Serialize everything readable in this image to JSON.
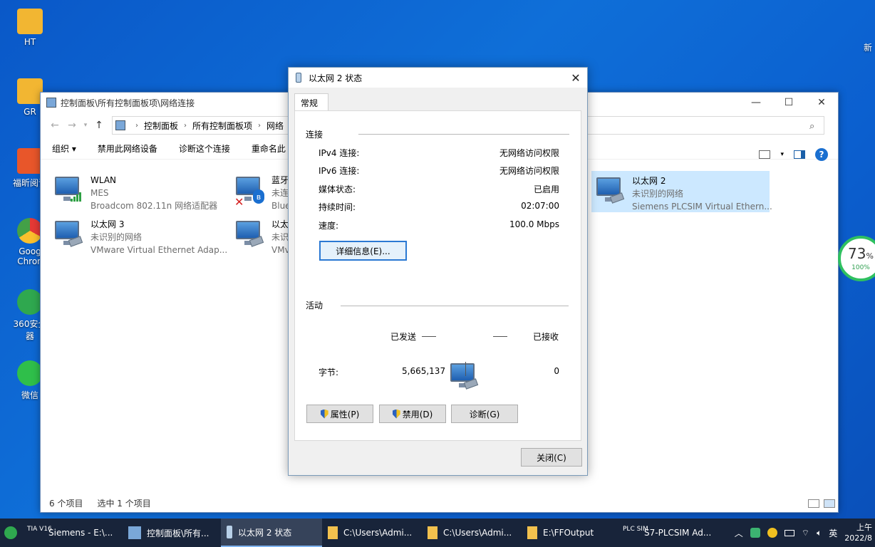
{
  "desktop": {
    "icons": [
      {
        "label": "HT",
        "color": "#f2b632"
      },
      {
        "label": "GR",
        "color": "#f2b632"
      },
      {
        "label": "福昕阅读",
        "color": "#e8562a"
      },
      {
        "label": "Goog Chron",
        "color": "#e53935"
      },
      {
        "label": "360安全 器",
        "color": "#2fa84f"
      },
      {
        "label": "微信",
        "color": "#2fbf4a"
      }
    ],
    "right_label": "新"
  },
  "explorer": {
    "title": "控制面板\\所有控制面板项\\网络连接",
    "breadcrumb": [
      "控制面板",
      "所有控制面板项",
      "网络"
    ],
    "toolbar": [
      "组织 ▾",
      "禁用此网络设备",
      "诊断这个连接",
      "重命名此"
    ],
    "items": [
      {
        "name": "WLAN",
        "status": "MES",
        "device": "Broadcom 802.11n 网络适配器",
        "kind": "wifi"
      },
      {
        "name": "蓝牙",
        "status": "未连",
        "device": "Blue",
        "kind": "bluetooth"
      },
      {
        "name": "以太网 2",
        "status": "未识别的网络",
        "device": "Siemens PLCSIM Virtual Ethern...",
        "kind": "ethernet"
      },
      {
        "name": "以太网 3",
        "status": "未识别的网络",
        "device": "VMware Virtual Ethernet Adap...",
        "kind": "ethernet"
      },
      {
        "name": "以太",
        "status": "未识",
        "device": "VMv",
        "kind": "ethernet"
      }
    ],
    "status_count": "6 个项目",
    "status_selected": "选中 1 个项目"
  },
  "dialog": {
    "title": "以太网 2 状态",
    "tab": "常规",
    "connection_group": "连接",
    "rows": [
      {
        "label": "IPv4 连接:",
        "value": "无网络访问权限"
      },
      {
        "label": "IPv6 连接:",
        "value": "无网络访问权限"
      },
      {
        "label": "媒体状态:",
        "value": "已启用"
      },
      {
        "label": "持续时间:",
        "value": "02:07:00"
      },
      {
        "label": "速度:",
        "value": "100.0 Mbps"
      }
    ],
    "details_button": "详细信息(E)...",
    "activity_group": "活动",
    "sent_label": "已发送",
    "received_label": "已接收",
    "bytes_label": "字节:",
    "bytes_sent": "5,665,137",
    "bytes_received": "0",
    "properties_button": "属性(P)",
    "disable_button": "禁用(D)",
    "diagnose_button": "诊断(G)",
    "close_button": "关闭(C)"
  },
  "widget": {
    "percent": "73",
    "percent_sign": "%",
    "battery": "100%"
  },
  "taskbar": {
    "items": [
      {
        "label": "Siemens - E:\\...",
        "badge": "TIA V16"
      },
      {
        "label": "控制面板\\所有..."
      },
      {
        "label": "以太网 2 状态"
      },
      {
        "label": "C:\\Users\\Admi..."
      },
      {
        "label": "C:\\Users\\Admi..."
      },
      {
        "label": "E:\\FFOutput"
      },
      {
        "label": "S7-PLCSIM Ad...",
        "badge": "PLC SIM"
      }
    ],
    "ime": "英",
    "time": "上午",
    "date": "2022/8"
  }
}
